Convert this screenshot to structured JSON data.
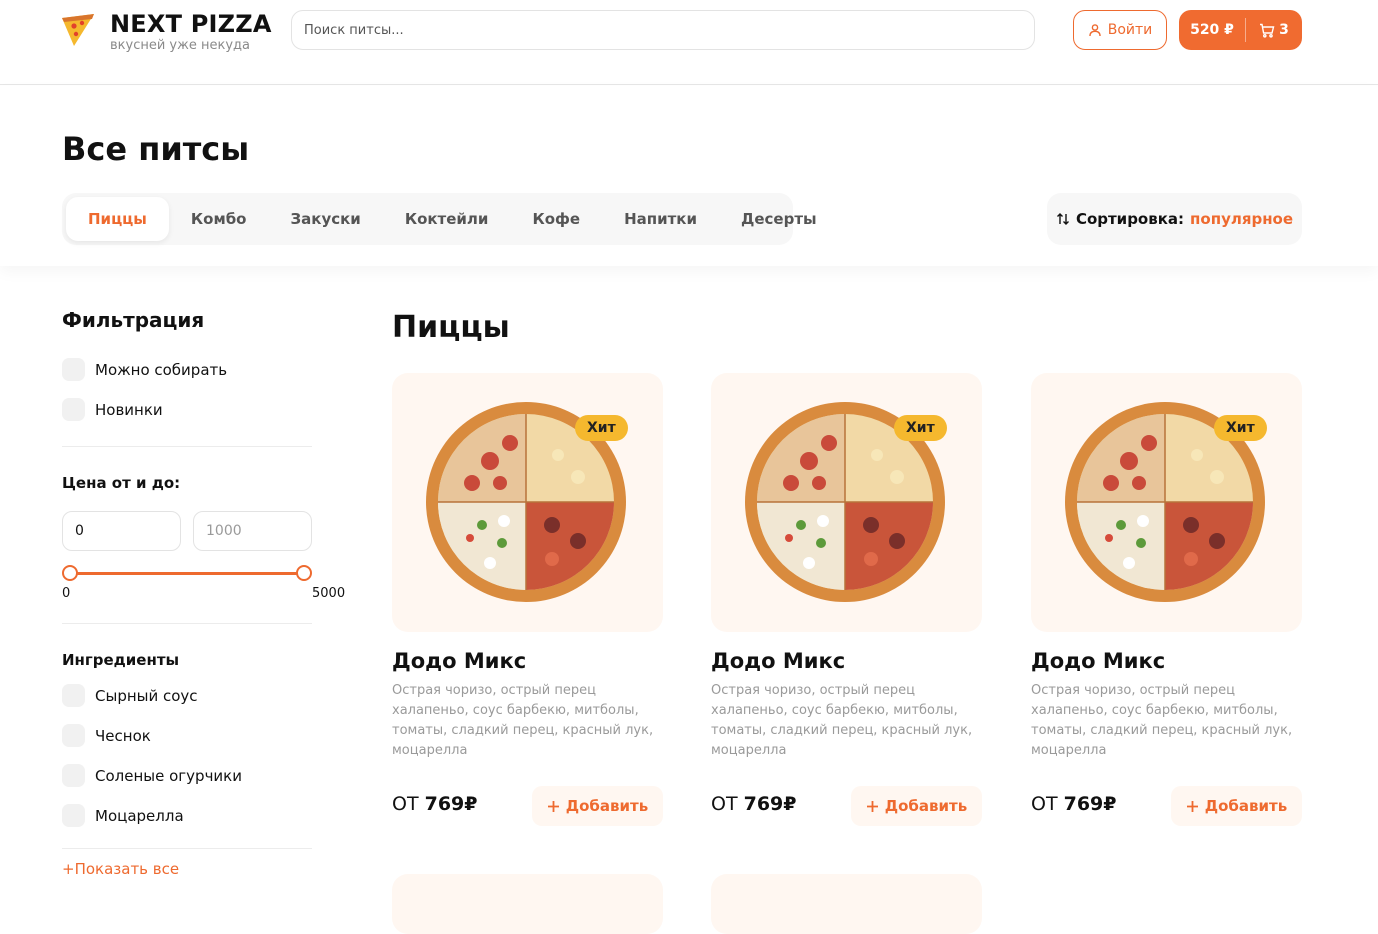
{
  "header": {
    "logo_title": "NEXT PIZZA",
    "logo_subtitle": "вкусней уже некуда",
    "search_placeholder": "Поиск питсы...",
    "login_label": "Войти",
    "cart_total": "520 ₽",
    "cart_count": "3"
  },
  "page": {
    "title": "Все питсы",
    "categories": [
      "Пиццы",
      "Комбо",
      "Закуски",
      "Коктейли",
      "Кофе",
      "Напитки",
      "Десерты"
    ],
    "active_category": "Пиццы",
    "sort_label": "Сортировка:",
    "sort_value": "популярное"
  },
  "filters": {
    "title": "Фильтрация",
    "options": [
      "Можно собирать",
      "Новинки"
    ],
    "price_heading": "Цена от и до:",
    "price_from": "0",
    "price_to_placeholder": "1000",
    "slider_min_label": "0",
    "slider_max_label": "5000",
    "slider_range": [
      0,
      5000
    ],
    "ingredients_heading": "Ингредиенты",
    "ingredients": [
      "Сырный соус",
      "Чеснок",
      "Соленые огурчики",
      "Моцарелла"
    ],
    "show_all_label": "+Показать все"
  },
  "products": {
    "section_title": "Пиццы",
    "items": [
      {
        "badge": "Хит",
        "name": "Додо Микс",
        "description": "Острая чоризо, острый перец халапеньо, соус барбекю, митболы, томаты, сладкий перец, красный лук, моцарелла",
        "price_prefix": "ОТ",
        "price": "769₽",
        "add_label": "Добавить"
      },
      {
        "badge": "Хит",
        "name": "Додо Микс",
        "description": "Острая чоризо, острый перец халапеньо, соус барбекю, митболы, томаты, сладкий перец, красный лук, моцарелла",
        "price_prefix": "ОТ",
        "price": "769₽",
        "add_label": "Добавить"
      },
      {
        "badge": "Хит",
        "name": "Додо Микс",
        "description": "Острая чоризо, острый перец халапеньо, соус барбекю, митболы, томаты, сладкий перец, красный лук, моцарелла",
        "price_prefix": "ОТ",
        "price": "769₽",
        "add_label": "Добавить"
      }
    ]
  },
  "colors": {
    "accent": "#ee6a2f",
    "badge": "#f5b82e",
    "card_bg": "#fff7f1"
  }
}
